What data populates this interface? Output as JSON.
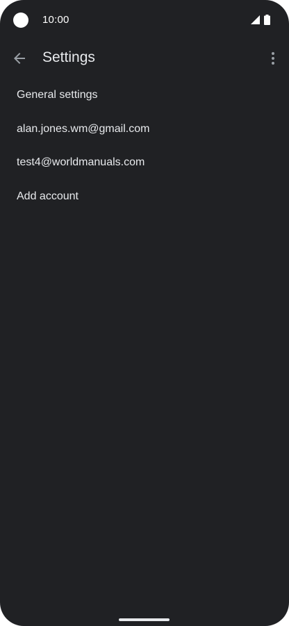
{
  "status_bar": {
    "time": "10:00",
    "icons": [
      "camera-cutout",
      "signal-icon",
      "battery-icon"
    ]
  },
  "app_bar": {
    "title": "Settings",
    "back_icon": "arrow-back-icon",
    "menu_icon": "more-vert-icon"
  },
  "settings_list": {
    "items": [
      {
        "label": "General settings"
      },
      {
        "label": "alan.jones.wm@gmail.com"
      },
      {
        "label": "test4@worldmanuals.com"
      },
      {
        "label": "Add account"
      }
    ]
  },
  "colors": {
    "background": "#202124",
    "text": "#e8eaed",
    "icon": "#9aa0a6"
  }
}
